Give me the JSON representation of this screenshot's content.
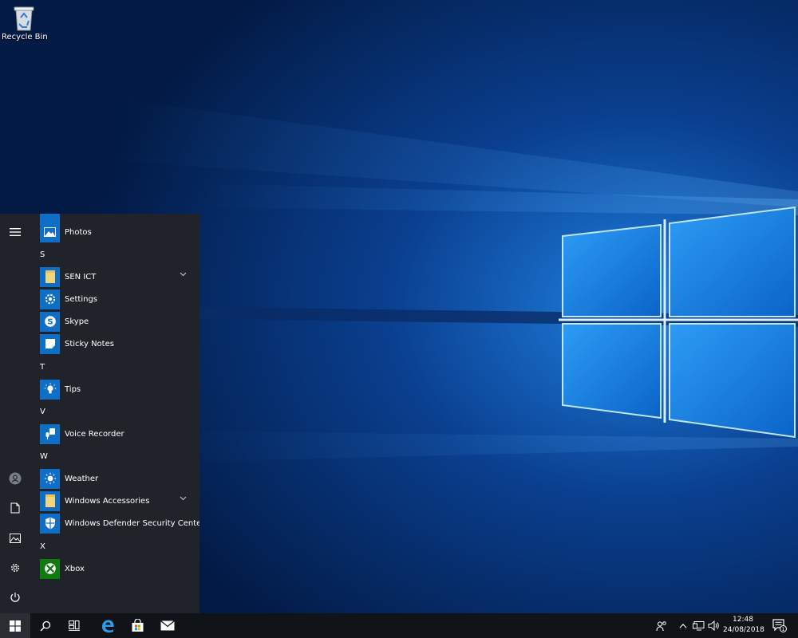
{
  "desktop": {
    "recycle_bin_label": "Recycle Bin",
    "icon": "recycle-bin-icon"
  },
  "start_menu": {
    "rail": {
      "menu_icon": "hamburger-icon",
      "account_icon": "user-icon",
      "documents_icon": "document-icon",
      "pictures_icon": "pictures-icon",
      "settings_icon": "gear-icon",
      "power_icon": "power-icon"
    },
    "apps": [
      {
        "type": "app",
        "label": "Photos",
        "icon": "photos-icon"
      },
      {
        "type": "letter",
        "label": "S"
      },
      {
        "type": "folder",
        "label": "SEN ICT",
        "icon": "folder-icon"
      },
      {
        "type": "app",
        "label": "Settings",
        "icon": "gear-icon"
      },
      {
        "type": "app",
        "label": "Skype",
        "icon": "skype-icon"
      },
      {
        "type": "app",
        "label": "Sticky Notes",
        "icon": "sticky-note-icon"
      },
      {
        "type": "letter",
        "label": "T"
      },
      {
        "type": "app",
        "label": "Tips",
        "icon": "lightbulb-icon"
      },
      {
        "type": "letter",
        "label": "V"
      },
      {
        "type": "app",
        "label": "Voice Recorder",
        "icon": "microphone-icon"
      },
      {
        "type": "letter",
        "label": "W"
      },
      {
        "type": "app",
        "label": "Weather",
        "icon": "sun-icon"
      },
      {
        "type": "folder",
        "label": "Windows Accessories",
        "icon": "folder-icon"
      },
      {
        "type": "app",
        "label": "Windows Defender Security Center",
        "icon": "shield-icon"
      },
      {
        "type": "letter",
        "label": "X"
      },
      {
        "type": "app",
        "label": "Xbox",
        "icon": "xbox-icon"
      }
    ]
  },
  "taskbar": {
    "start_icon": "windows-logo-icon",
    "search_icon": "search-icon",
    "task_view_icon": "task-view-icon",
    "edge_icon": "edge-browser-icon",
    "store_icon": "store-icon",
    "mail_icon": "mail-icon",
    "tray": {
      "people_icon": "people-icon",
      "chevron_icon": "chevron-up-icon",
      "network_icon": "network-icon",
      "volume_icon": "volume-icon",
      "notification_icon": "action-center-icon",
      "notification_count": "1"
    },
    "clock": {
      "time": "12:48",
      "date": "24/08/2018"
    }
  },
  "colors": {
    "accent": "#0f6fc6",
    "start_menu_bg": "#20242a",
    "taskbar_bg": "#101317",
    "xbox_green": "#107c10"
  }
}
